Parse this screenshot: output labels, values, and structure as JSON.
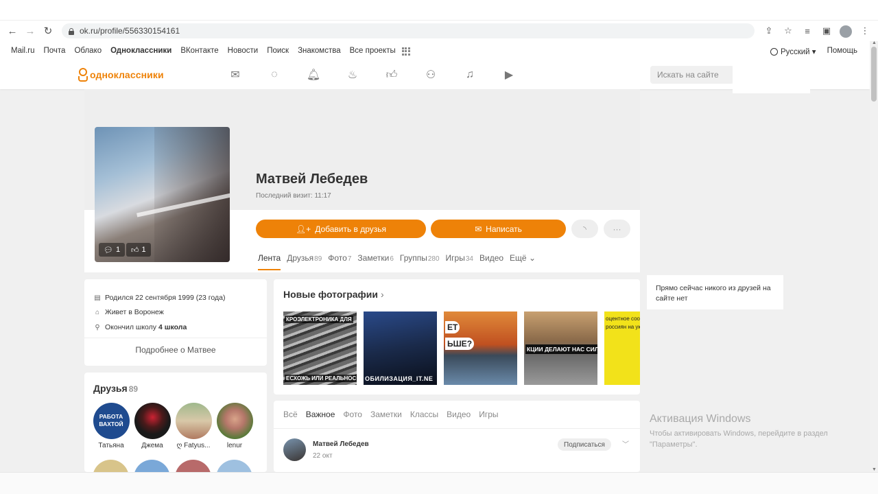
{
  "browser": {
    "url": "ok.ru/profile/556330154161"
  },
  "projects_bar": {
    "links": [
      "Mail.ru",
      "Почта",
      "Облако",
      "Одноклассники",
      "ВКонтакте",
      "Новости",
      "Поиск",
      "Знакомства",
      "Все проекты"
    ],
    "active": "Одноклассники",
    "language": "Русский",
    "help": "Помощь"
  },
  "header": {
    "logo_text": "одноклассники",
    "search_placeholder": "Искать на сайте",
    "nav_icons": [
      "messages-icon",
      "discussions-icon",
      "notifications-icon",
      "guests-icon",
      "events-icon",
      "video-call-icon",
      "music-icon",
      "video-icon"
    ]
  },
  "profile": {
    "name": "Матвей Лебедев",
    "last_visit": "Последний визит: 11:17",
    "comments_count": "1",
    "likes_count": "1",
    "add_friend": "Добавить в друзья",
    "write": "Написать",
    "more": "···",
    "tabs": [
      {
        "label": "Лента",
        "count": ""
      },
      {
        "label": "Друзья",
        "count": "89"
      },
      {
        "label": "Фото",
        "count": "7"
      },
      {
        "label": "Заметки",
        "count": "6"
      },
      {
        "label": "Группы",
        "count": "280"
      },
      {
        "label": "Игры",
        "count": "34"
      },
      {
        "label": "Видео",
        "count": ""
      },
      {
        "label": "Ещё",
        "count": ""
      }
    ]
  },
  "info": {
    "born": "Родился 22 сентября 1999 (23 года)",
    "lives": "Живет в Воронеж",
    "school_prefix": "Окончил школу ",
    "school": "4 школа",
    "more": "Подробнее о Матвее"
  },
  "friends": {
    "title": "Друзья",
    "count": "89",
    "items": [
      {
        "name": "Татьяна",
        "avatar_text_1": "РАБОТА",
        "avatar_text_2": "ВАХТОЙ"
      },
      {
        "name": "Джема"
      },
      {
        "name": "ღ Fatyus..."
      },
      {
        "name": "lenur"
      }
    ]
  },
  "photos": {
    "title": "Новые фотографии",
    "chevron": "›",
    "items": [
      {
        "top": "КРОЭЛЕКТРОНИКА ДЛЯ",
        "bottom": "ЕСХОЖЬ ИЛИ РЕАЛЬНОС"
      },
      {
        "top": "",
        "bottom": "ОБИЛИЗАЦИЯ_IT.NE"
      },
      {
        "top": "ЕТ",
        "bottom": "ЬШЕ?"
      },
      {
        "top": "",
        "bottom": "КЦИИ ДЕЛАЮТ НАС СИЛЬН"
      },
      {
        "top": "оцентное соот",
        "bottom": "россиян на указ"
      }
    ]
  },
  "feed": {
    "tabs": [
      "Всё",
      "Важное",
      "Фото",
      "Заметки",
      "Классы",
      "Видео",
      "Игры"
    ],
    "active": "Важное",
    "post": {
      "author": "Матвей Лебедев",
      "date": "22 окт",
      "subscribe": "Подписаться"
    }
  },
  "online": {
    "text": "Прямо сейчас никого из друзей на сайте нет"
  },
  "watermark": {
    "title": "Активация Windows",
    "line1": "Чтобы активировать Windows, перейдите в раздел",
    "line2": "\"Параметры\"."
  },
  "colors": {
    "accent": "#ee8208",
    "background": "#f0f0f0"
  }
}
